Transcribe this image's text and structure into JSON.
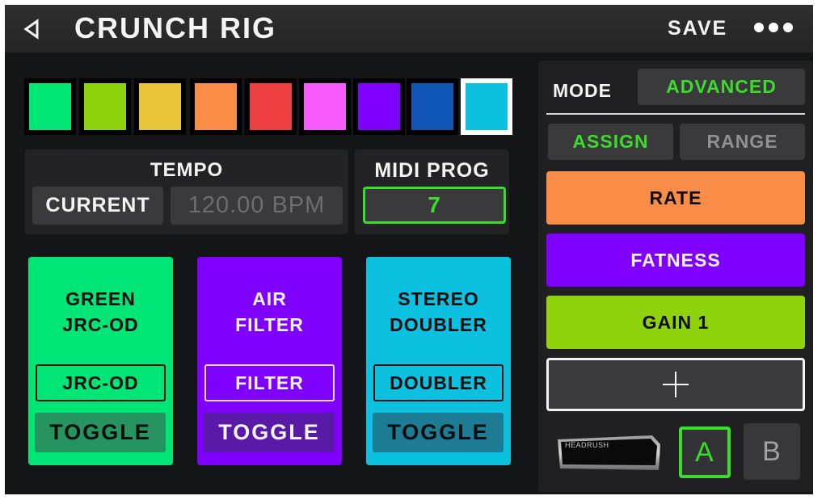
{
  "header": {
    "title": "CRUNCH RIG",
    "save_label": "SAVE",
    "back_icon": "back-triangle-icon",
    "more_icon": "more-dots-icon"
  },
  "colors": {
    "swatches": [
      "#00e676",
      "#8ed30b",
      "#e8c53a",
      "#f98d48",
      "#ed3f3f",
      "#f75bfc",
      "#7f00ff",
      "#0f56b5",
      "#0cc1e0"
    ],
    "selected_index": 8,
    "accent_green": "#3bdc2b"
  },
  "tempo": {
    "label": "TEMPO",
    "mode_label": "CURRENT",
    "bpm_value": "120.00 BPM"
  },
  "midi": {
    "label": "MIDI PROG",
    "value": "7"
  },
  "blocks": [
    {
      "name": "GREEN\nJRC-OD",
      "param": "JRC-OD",
      "action": "TOGGLE",
      "color": "#00e676"
    },
    {
      "name": "AIR\nFILTER",
      "param": "FILTER",
      "action": "TOGGLE",
      "color": "#7f00ff"
    },
    {
      "name": "STEREO\nDOUBLER",
      "param": "DOUBLER",
      "action": "TOGGLE",
      "color": "#0cc1e0"
    }
  ],
  "side_panel": {
    "mode_label": "MODE",
    "mode_value": "ADVANCED",
    "tabs": [
      {
        "label": "ASSIGN",
        "active": true
      },
      {
        "label": "RANGE",
        "active": false
      }
    ],
    "assignments": [
      {
        "label": "RATE",
        "color": "#f98d48"
      },
      {
        "label": "FATNESS",
        "color": "#7f00ff"
      },
      {
        "label": "GAIN 1",
        "color": "#8ed30b"
      }
    ],
    "add_icon": "plus-icon",
    "pedal_brand": "HEADRUSH",
    "pedal_slots": [
      {
        "label": "A",
        "selected": true
      },
      {
        "label": "B",
        "selected": false
      }
    ]
  }
}
